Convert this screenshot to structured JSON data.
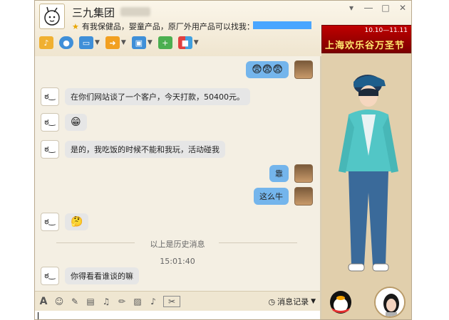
{
  "window": {
    "title_name": "三九集团",
    "status_text": "有我保健品，婴童产品，原厂外用产品可以找我：",
    "controls": {
      "minimize": "▾",
      "restore": "―",
      "maximize": "□",
      "close": "✕"
    }
  },
  "toolbar": {
    "items": [
      {
        "name": "voice-call",
        "icon": "microphone-icon",
        "color": "#f0b030"
      },
      {
        "name": "video-call",
        "icon": "camera-icon",
        "color": "#3f8fd8"
      },
      {
        "name": "remote-assist",
        "icon": "screen-icon",
        "color": "#3f8fd8"
      },
      {
        "name": "file-transfer",
        "icon": "folder-icon",
        "color": "#f2a020"
      },
      {
        "name": "screen-share",
        "icon": "share-screen-icon",
        "color": "#3f8fd8"
      },
      {
        "name": "create-discussion",
        "icon": "add-group-icon",
        "color": "#4caf50"
      },
      {
        "name": "apps",
        "icon": "apps-icon",
        "color": "#e04040"
      }
    ]
  },
  "ad": {
    "date_text": "10.10—11.11",
    "headline": "上海欢乐谷万圣节"
  },
  "messages": [
    {
      "side": "right",
      "text": "😨😨😨"
    },
    {
      "side": "left",
      "text": "在你们网站谈了一个客户，今天打款，50400元。"
    },
    {
      "side": "left",
      "text": "😁"
    },
    {
      "side": "left",
      "text": "是的，我吃饭的时候不能和我玩，活动碰我"
    },
    {
      "side": "right",
      "text": "靠"
    },
    {
      "side": "right",
      "text": "这么牛"
    },
    {
      "side": "left",
      "text": "🤔"
    },
    {
      "side": "left",
      "text": "你得看看谁谈的嘛"
    }
  ],
  "history_divider": "以上是历史消息",
  "timestamp": "15:01:40",
  "input_toolbar": {
    "history_label": "消息记录",
    "items": [
      "font-icon",
      "emoji-icon",
      "shake-icon",
      "voice-message-icon",
      "mic-icon",
      "edit-icon",
      "image-icon",
      "music-icon",
      "screenshot-icon"
    ]
  }
}
